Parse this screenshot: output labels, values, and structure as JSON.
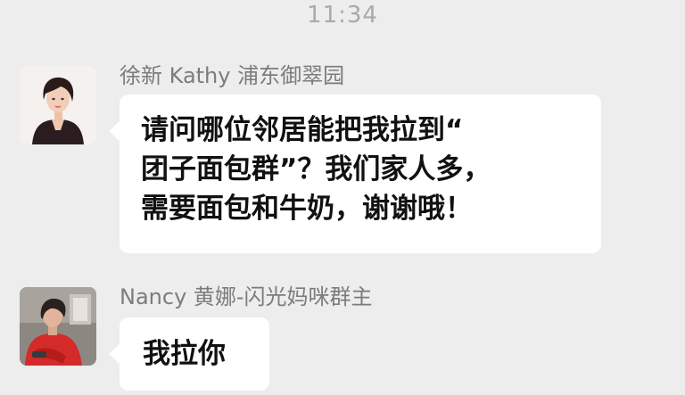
{
  "status": {
    "time": "11:34"
  },
  "messages": [
    {
      "sender": "徐新 Kathy 浦东御翠园",
      "text": "请问哪位邻居能把我拉到“\n团子面包群”？我们家人多，\n需要面包和牛奶，谢谢哦！",
      "avatar_icon": "woman-portrait-avatar"
    },
    {
      "sender": "Nancy 黄娜-闪光妈咪群主",
      "text": "我拉你",
      "avatar_icon": "woman-red-sweater-avatar"
    }
  ],
  "colors": {
    "background": "#ededed",
    "bubble": "#ffffff",
    "sender_name": "#7c7c7c",
    "message_text": "#111111",
    "timestamp": "#a9a9a9"
  }
}
